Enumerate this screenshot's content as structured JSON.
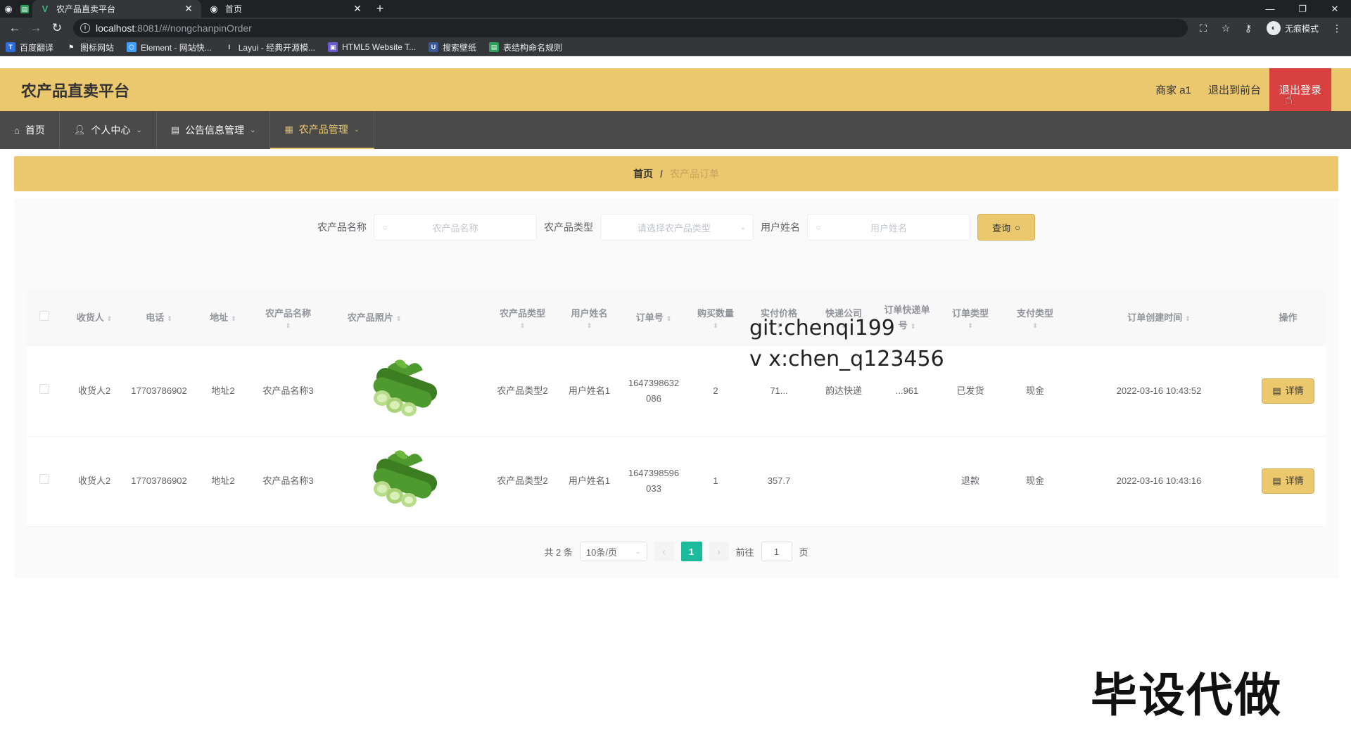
{
  "browser": {
    "tabs": [
      {
        "title": "农产品直卖平台",
        "active": true
      },
      {
        "title": "首页",
        "active": false
      }
    ],
    "url_host": "localhost",
    "url_path": ":8081/#/nongchanpinOrder",
    "profile_label": "无痕模式",
    "bookmarks": [
      {
        "label": "百度翻译",
        "icon_color": "#2d6cdf"
      },
      {
        "label": "图标网站",
        "icon_color": "#555555"
      },
      {
        "label": "Element - 网站快...",
        "icon_color": "#409eff"
      },
      {
        "label": "Layui - 经典开源模...",
        "icon_color": "#666666"
      },
      {
        "label": "HTML5 Website T...",
        "icon_color": "#6a5acd"
      },
      {
        "label": "搜索壁纸",
        "icon_color": "#3b5998"
      },
      {
        "label": "表结构命名规则",
        "icon_color": "#2e9e5b"
      }
    ]
  },
  "header": {
    "title": "农产品直卖平台",
    "user": "商家 a1",
    "back_front": "退出到前台",
    "logout": "退出登录"
  },
  "menu": [
    {
      "label": "首页",
      "icon": "home-icon",
      "active": false
    },
    {
      "label": "个人中心",
      "icon": "user-icon",
      "active": false
    },
    {
      "label": "公告信息管理",
      "icon": "notice-icon",
      "active": false
    },
    {
      "label": "农产品管理",
      "icon": "product-icon",
      "active": true
    }
  ],
  "breadcrumb": {
    "home": "首页",
    "separator": "/",
    "current": "农产品订单"
  },
  "search": {
    "name_label": "农产品名称",
    "name_placeholder": "农产品名称",
    "type_label": "农产品类型",
    "type_placeholder": "请选择农产品类型",
    "user_label": "用户姓名",
    "user_placeholder": "用户姓名",
    "query_button": "查询"
  },
  "table": {
    "headers": {
      "receiver": "收货人",
      "phone": "电话",
      "address": "地址",
      "product_name": "农产品名称",
      "product_photo": "农产品照片",
      "product_type": "农产品类型",
      "user_name": "用户姓名",
      "order_no": "订单号",
      "quantity": "购买数量",
      "price": "实付价格",
      "express_company": "快递公司",
      "express_no": "订单快递单号",
      "order_type": "订单类型",
      "pay_type": "支付类型",
      "created": "订单创建时间",
      "actions": "操作"
    },
    "rows": [
      {
        "receiver": "收货人2",
        "phone": "17703786902",
        "address": "地址2",
        "product_name": "农产品名称3",
        "product_type": "农产品类型2",
        "user_name": "用户姓名1",
        "order_no": "1647398632086",
        "quantity": "2",
        "price": "71...",
        "express_company": "韵达快递",
        "express_no": "...961",
        "order_type": "已发货",
        "pay_type": "现金",
        "created": "2022-03-16 10:43:52",
        "detail": "详情"
      },
      {
        "receiver": "收货人2",
        "phone": "17703786902",
        "address": "地址2",
        "product_name": "农产品名称3",
        "product_type": "农产品类型2",
        "user_name": "用户姓名1",
        "order_no": "1647398596033",
        "quantity": "1",
        "price": "357.7",
        "express_company": "",
        "express_no": "",
        "order_type": "退款",
        "pay_type": "现金",
        "created": "2022-03-16 10:43:16",
        "detail": "详情"
      }
    ]
  },
  "pagination": {
    "total": "共 2 条",
    "page_size": "10条/页",
    "current_page": "1",
    "goto_label": "前往",
    "goto_value": "1",
    "page_suffix": "页"
  },
  "watermark": {
    "line1": "git:chenqi199",
    "line2": "v x:chen_q123456",
    "stamp": "毕设代做"
  },
  "colors": {
    "accent": "#ebc76e",
    "menu_bg": "#4a4a4a",
    "logout_bg": "#d94040",
    "page_active": "#1abc9c"
  }
}
